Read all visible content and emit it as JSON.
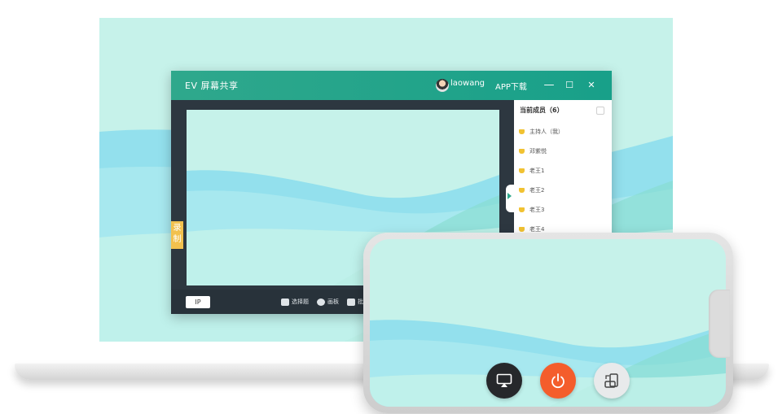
{
  "app": {
    "title": "EV 屏幕共享",
    "username": "laowang",
    "download_label": "APP下载",
    "minimize_label": "—",
    "maximize_label": "☐",
    "close_label": "✕"
  },
  "record_tab": {
    "label": "录制"
  },
  "bottom_bar": {
    "ip_label": "IP",
    "tools": [
      {
        "label": "选择题",
        "icon": "edit-icon"
      },
      {
        "label": "画板",
        "icon": "palette-icon"
      },
      {
        "label": "批",
        "icon": "folder-icon"
      }
    ]
  },
  "members": {
    "title": "当前成员（6）",
    "items": [
      {
        "name": "主持人（我）"
      },
      {
        "name": "邓紫悦"
      },
      {
        "name": "老王1"
      },
      {
        "name": "老王2"
      },
      {
        "name": "老王3"
      },
      {
        "name": "老王4"
      }
    ]
  },
  "phone_controls": {
    "cast_icon": "cast-icon",
    "power_icon": "power-icon",
    "rotate_icon": "rotate-screen-icon"
  },
  "colors": {
    "accent": "#1fa58a",
    "power": "#f45d2c",
    "dark_button": "#26282b",
    "light_button": "#e8eaeb",
    "record_tab": "#f2c14e",
    "mint": "#c6f2ea"
  }
}
